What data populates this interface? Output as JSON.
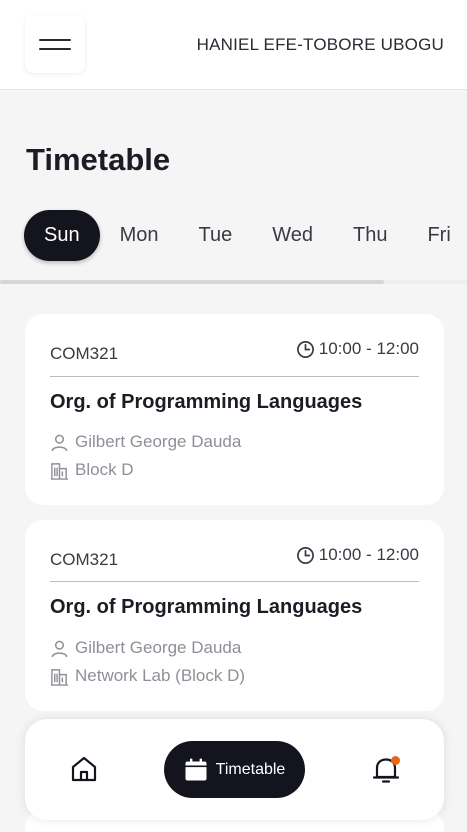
{
  "header": {
    "user_name": "HANIEL EFE-TOBORE UBOGU",
    "menu_icon": "hamburger-menu-icon"
  },
  "page": {
    "title": "Timetable"
  },
  "days": {
    "items": [
      {
        "label": "Sun",
        "active": true
      },
      {
        "label": "Mon",
        "active": false
      },
      {
        "label": "Tue",
        "active": false
      },
      {
        "label": "Wed",
        "active": false
      },
      {
        "label": "Thu",
        "active": false
      },
      {
        "label": "Fri",
        "active": false
      }
    ]
  },
  "classes": [
    {
      "code": "COM321",
      "time": "10:00 - 12:00",
      "course": "Org. of Programming Languages",
      "lecturer": "Gilbert George Dauda",
      "venue": "Block D"
    },
    {
      "code": "COM321",
      "time": "10:00 - 12:00",
      "course": "Org. of Programming Languages",
      "lecturer": "Gilbert George Dauda",
      "venue": "Network Lab (Block D)"
    }
  ],
  "bottom_nav": {
    "home_icon": "home-icon",
    "timetable_label": "Timetable",
    "timetable_icon": "calendar-icon",
    "bell_icon": "bell-icon",
    "notification_color": "#e8661a"
  },
  "colors": {
    "primary_dark": "#14141f",
    "background": "#f5f5f5",
    "muted_text": "#8f8f97"
  }
}
